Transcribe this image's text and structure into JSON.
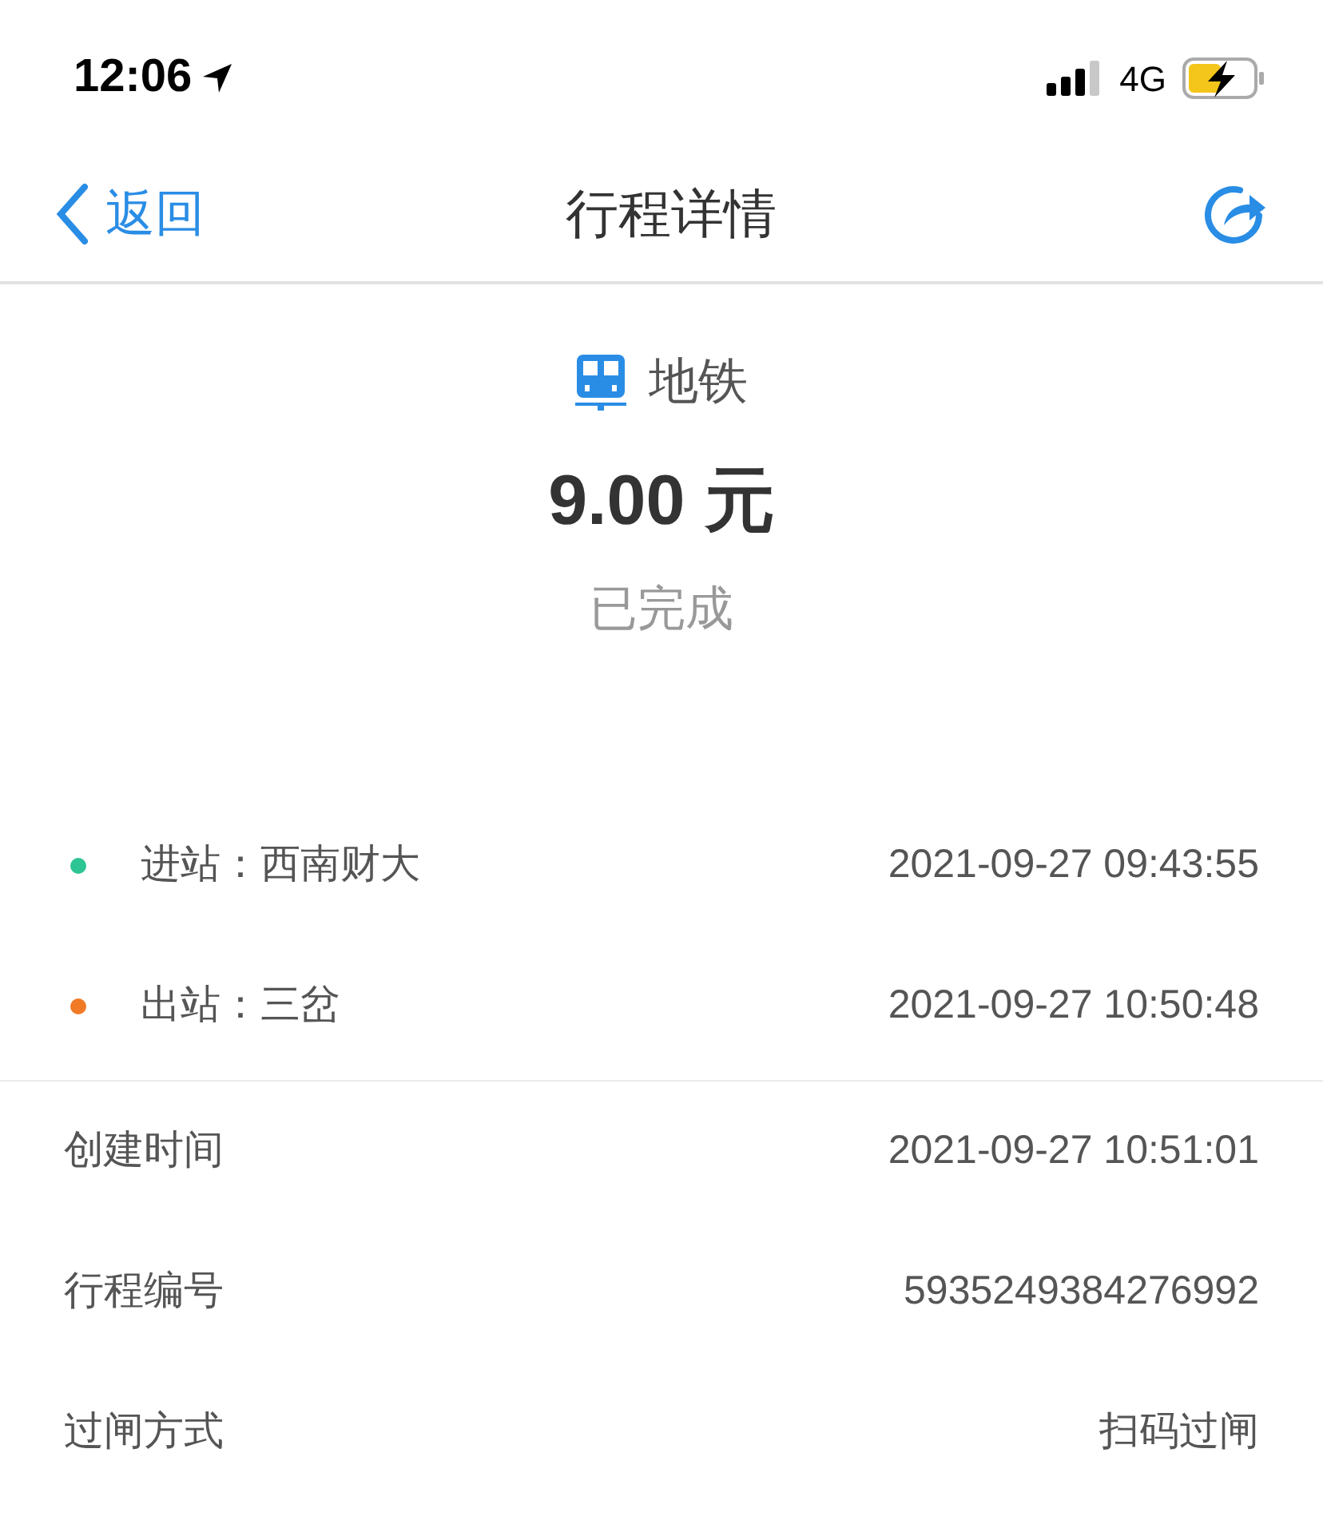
{
  "status_bar": {
    "time": "12:06",
    "network": "4G"
  },
  "nav": {
    "back": "返回",
    "title": "行程详情"
  },
  "trip": {
    "mode": "地铁",
    "amount": "9.00 元",
    "status": "已完成"
  },
  "stations": [
    {
      "label": "进站：西南财大",
      "time": "2021-09-27 09:43:55",
      "color": "#2dc593"
    },
    {
      "label": "出站：三岔",
      "time": "2021-09-27 10:50:48",
      "color": "#f07a26"
    }
  ],
  "details": [
    {
      "label": "创建时间",
      "value": "2021-09-27 10:51:01"
    },
    {
      "label": "行程编号",
      "value": "5935249384276992"
    },
    {
      "label": "过闸方式",
      "value": "扫码过闸"
    }
  ]
}
